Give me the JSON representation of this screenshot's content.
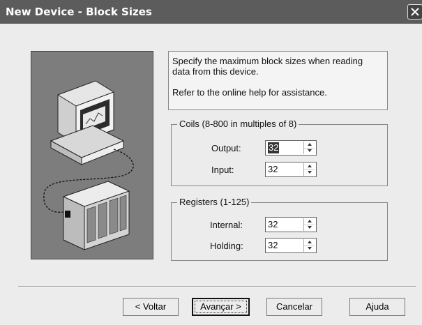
{
  "window": {
    "title": "New Device - Block Sizes"
  },
  "icons": {
    "close": "close-icon",
    "illustration": "computer-plc-illustration"
  },
  "info": {
    "line1": "Specify the maximum block sizes when reading",
    "line2": "data from this device.",
    "line3": "Refer to the online help for assistance."
  },
  "coils": {
    "legend": "Coils (8-800 in multiples of 8)",
    "output_label": "Output:",
    "output_value": "32",
    "input_label": "Input:",
    "input_value": "32"
  },
  "registers": {
    "legend": "Registers (1-125)",
    "internal_label": "Internal:",
    "internal_value": "32",
    "holding_label": "Holding:",
    "holding_value": "32"
  },
  "buttons": {
    "back": "< Voltar",
    "next": "Avançar >",
    "cancel": "Cancelar",
    "help": "Ajuda"
  }
}
